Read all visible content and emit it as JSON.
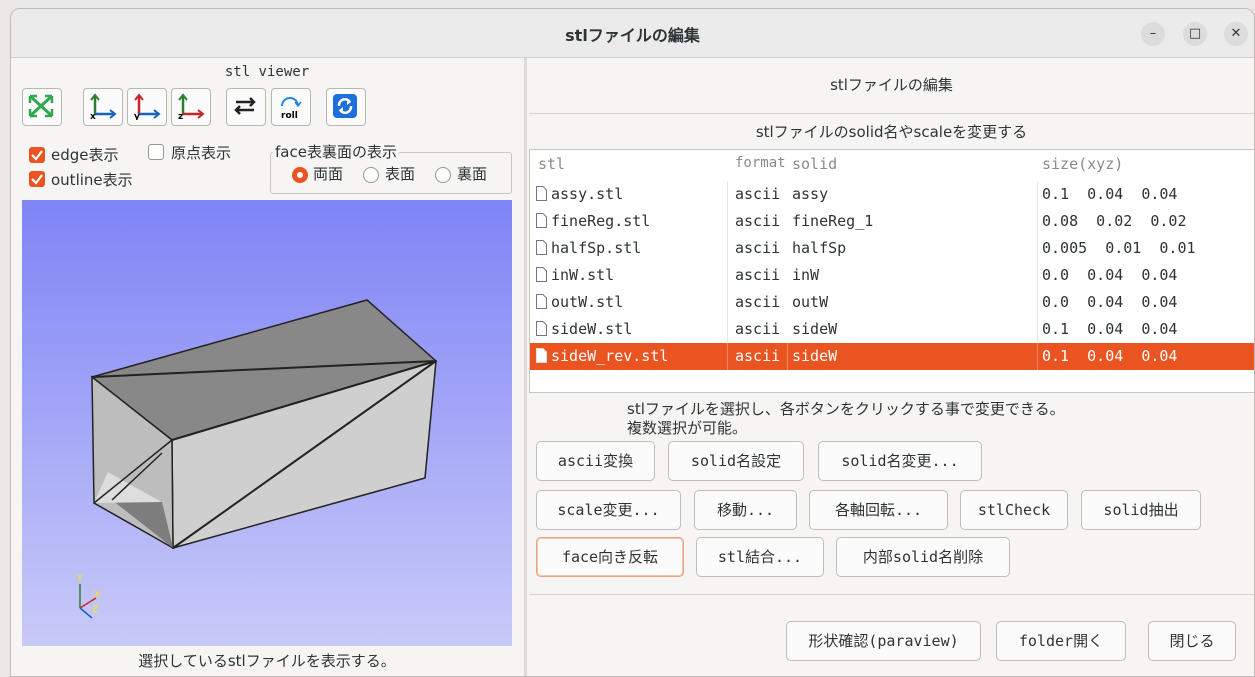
{
  "window": {
    "title": "stlファイルの編集",
    "minimize_glyph": "–",
    "maximize_glyph": "□",
    "close_glyph": "✕"
  },
  "viewer": {
    "title": "stl viewer",
    "toolbar_icons": [
      "fit-view-icon",
      "x-axis-view-icon",
      "y-axis-view-icon",
      "z-axis-view-icon",
      "swap-icon",
      "roll-icon",
      "refresh-icon"
    ],
    "roll_label": "roll",
    "edge_label": "edge表示",
    "edge_checked": true,
    "origin_label": "原点表示",
    "origin_checked": false,
    "outline_label": "outline表示",
    "outline_checked": true,
    "face_group_label": "face表裏面の表示",
    "face_options": [
      "両面",
      "表面",
      "裏面"
    ],
    "face_selected": "両面",
    "axis_x": "X",
    "axis_y": "Y",
    "axis_z": "Z",
    "footer": "選択しているstlファイルを表示する。",
    "colors": {
      "viewport_top": "#7f84f6",
      "viewport_bottom": "#c9caf8",
      "accent": "#e95420"
    }
  },
  "editor": {
    "title": "stlファイルの編集",
    "subtitle": "stlファイルのsolid名やscaleを変更する",
    "columns": [
      "stl",
      "format",
      "solid",
      "size(xyz)"
    ],
    "rows": [
      {
        "stl": "assy.stl",
        "format": "ascii",
        "solid": "assy",
        "size": "0.1  0.04  0.04"
      },
      {
        "stl": "fineReg.stl",
        "format": "ascii",
        "solid": "fineReg_1",
        "size": "0.08  0.02  0.02"
      },
      {
        "stl": "halfSp.stl",
        "format": "ascii",
        "solid": "halfSp",
        "size": "0.005  0.01  0.01"
      },
      {
        "stl": "inW.stl",
        "format": "ascii",
        "solid": "inW",
        "size": "0.0  0.04  0.04"
      },
      {
        "stl": "outW.stl",
        "format": "ascii",
        "solid": "outW",
        "size": "0.0  0.04  0.04"
      },
      {
        "stl": "sideW.stl",
        "format": "ascii",
        "solid": "sideW",
        "size": "0.1  0.04  0.04"
      },
      {
        "stl": "sideW_rev.stl",
        "format": "ascii",
        "solid": "sideW",
        "size": "0.1  0.04  0.04"
      }
    ],
    "selected_row": "sideW_rev.stl",
    "instruction_line1": "stlファイルを選択し、各ボタンをクリックする事で変更できる。",
    "instruction_line2": "複数選択が可能。",
    "buttons": {
      "ascii": "ascii変換",
      "solid_set": "solid名設定",
      "solid_rename": "solid名変更...",
      "scale": "scale変更...",
      "move": "移動...",
      "rotate": "各軸回転...",
      "stlcheck": "stlCheck",
      "solid_extract": "solid抽出",
      "face_flip": "face向き反転",
      "stl_merge": "stl結合...",
      "inner_solid_delete": "内部solid名削除",
      "paraview": "形状確認(paraview)",
      "folder_open": "folder開く",
      "close": "閉じる"
    }
  }
}
